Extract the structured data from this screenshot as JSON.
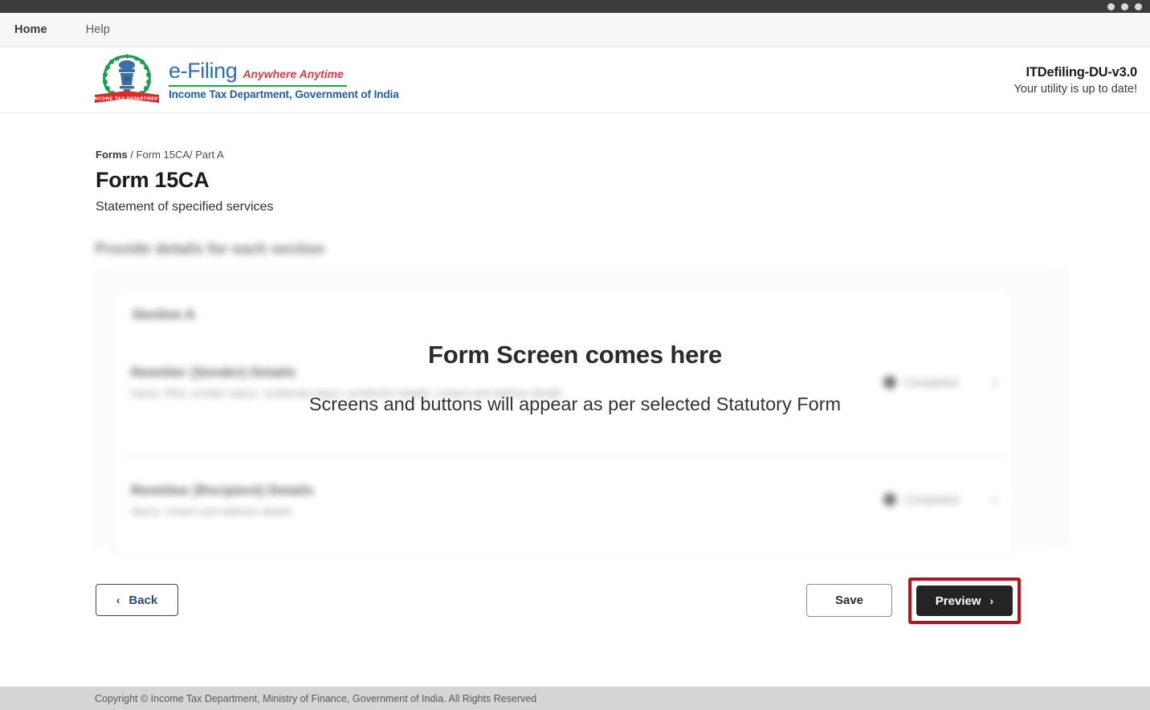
{
  "window": {
    "controls": [
      {
        "name": "minimize-dot"
      },
      {
        "name": "maximize-dot"
      },
      {
        "name": "close-dot"
      }
    ]
  },
  "topnav": {
    "items": [
      {
        "label": "Home",
        "active": true
      },
      {
        "label": "Help",
        "active": false
      }
    ]
  },
  "brand": {
    "emblem_alt": "india-emblem-icon",
    "efiling": "e-Filing",
    "tagline": "Anywhere Anytime",
    "department": "Income Tax Department, Government of India",
    "colors": {
      "efiling_blue": "#2a6fb5",
      "tagline_red": "#d63f4a",
      "rule_green": "#23a24d",
      "department_blue": "#1d5fa8"
    }
  },
  "version": {
    "name": "ITDefiling-DU-v3.0",
    "status": "Your utility is up to date!"
  },
  "page": {
    "breadcrumb": {
      "root": "Forms",
      "rest": " / Form 15CA/ Part A"
    },
    "title": "Form 15CA",
    "subtitle": "Statement of specified services"
  },
  "overlay": {
    "heading": "Form Screen comes here",
    "subheading": "Screens and buttons will appear as per selected Statutory Form"
  },
  "form_content": {
    "section_heading": "Provide details for each section",
    "card_title": "Section A",
    "rows": [
      {
        "title": "Remitter (Sender) Details",
        "subtitle": "Name, PAN, remitter status, residential status, jurisdiction details, contact and address details",
        "status": "Completed",
        "chevron": "›"
      },
      {
        "title": "Remittee (Recipient) Details",
        "subtitle": "Name, contact and address details",
        "status": "Completed",
        "chevron": "›"
      }
    ]
  },
  "actions": {
    "back": {
      "label": "Back",
      "icon": "‹"
    },
    "save": {
      "label": "Save"
    },
    "preview": {
      "label": "Preview",
      "icon": "›",
      "highlight_color": "#b3161c"
    }
  },
  "footer": {
    "copyright": "Copyright © Income Tax Department, Ministry of Finance, Government of India. All Rights Reserved"
  }
}
